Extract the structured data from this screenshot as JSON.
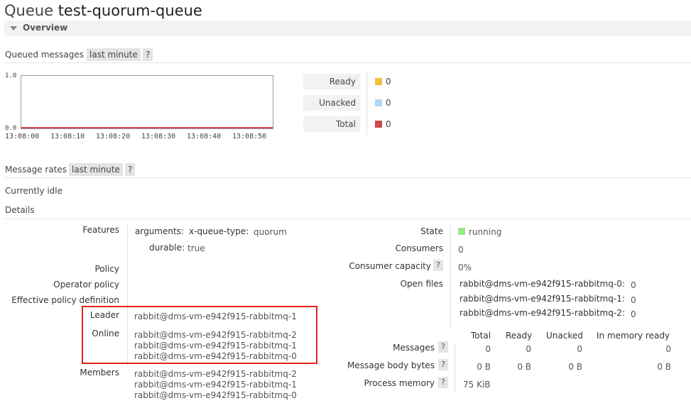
{
  "page": {
    "title_prefix": "Queue",
    "queue_name": "test-quorum-queue"
  },
  "overview": {
    "label": "Overview"
  },
  "queued_messages": {
    "label": "Queued messages",
    "range": "last minute",
    "help": "?",
    "y_max": "1.0",
    "y_min": "0.0",
    "time_ticks": [
      "13:08:00",
      "13:08:10",
      "13:08:20",
      "13:08:30",
      "13:08:40",
      "13:08:50"
    ],
    "legend": [
      {
        "name": "Ready",
        "value": "0",
        "color": "#edc240"
      },
      {
        "name": "Unacked",
        "value": "0",
        "color": "#afd8f8"
      },
      {
        "name": "Total",
        "value": "0",
        "color": "#cb4b4b"
      }
    ]
  },
  "chart_data": {
    "type": "line",
    "x": [
      "13:08:00",
      "13:08:10",
      "13:08:20",
      "13:08:30",
      "13:08:40",
      "13:08:50"
    ],
    "series": [
      {
        "name": "Ready",
        "values": [
          0,
          0,
          0,
          0,
          0,
          0
        ]
      },
      {
        "name": "Unacked",
        "values": [
          0,
          0,
          0,
          0,
          0,
          0
        ]
      },
      {
        "name": "Total",
        "values": [
          0,
          0,
          0,
          0,
          0,
          0
        ]
      }
    ],
    "ylim": [
      0,
      1.0
    ]
  },
  "message_rates": {
    "label": "Message rates",
    "range": "last minute",
    "help": "?",
    "status": "Currently idle"
  },
  "details": {
    "label": "Details",
    "features_label": "Features",
    "arguments_key": "arguments:",
    "queue_type_key": "x-queue-type:",
    "queue_type_value": "quorum",
    "durable_key": "durable:",
    "durable_value": "true",
    "policy_label": "Policy",
    "operator_policy_label": "Operator policy",
    "effective_policy_label": "Effective policy definition",
    "leader_label": "Leader",
    "leader_value": "rabbit@dms-vm-e942f915-rabbitmq-1",
    "online_label": "Online",
    "online_nodes": [
      "rabbit@dms-vm-e942f915-rabbitmq-2",
      "rabbit@dms-vm-e942f915-rabbitmq-1",
      "rabbit@dms-vm-e942f915-rabbitmq-0"
    ],
    "members_label": "Members",
    "members": [
      "rabbit@dms-vm-e942f915-rabbitmq-2",
      "rabbit@dms-vm-e942f915-rabbitmq-1",
      "rabbit@dms-vm-e942f915-rabbitmq-0"
    ],
    "state_label": "State",
    "state_value": "running",
    "state_color": "#98e68a",
    "consumers_label": "Consumers",
    "consumers_value": "0",
    "consumer_capacity_label": "Consumer capacity",
    "consumer_capacity_value": "0%",
    "open_files_label": "Open files",
    "open_files": [
      {
        "node": "rabbit@dms-vm-e942f915-rabbitmq-0:",
        "count": "0"
      },
      {
        "node": "rabbit@dms-vm-e942f915-rabbitmq-1:",
        "count": "0"
      },
      {
        "node": "rabbit@dms-vm-e942f915-rabbitmq-2:",
        "count": "0"
      }
    ],
    "stats_headers": [
      "Total",
      "Ready",
      "Unacked",
      "In memory ready"
    ],
    "messages_label": "Messages",
    "messages_values": [
      "0",
      "0",
      "0",
      "0"
    ],
    "body_bytes_label": "Message body bytes",
    "body_bytes_values": [
      "0 B",
      "0 B",
      "0 B",
      "0 B"
    ],
    "process_memory_label": "Process memory",
    "process_memory_value": "75 KiB",
    "help": "?"
  }
}
